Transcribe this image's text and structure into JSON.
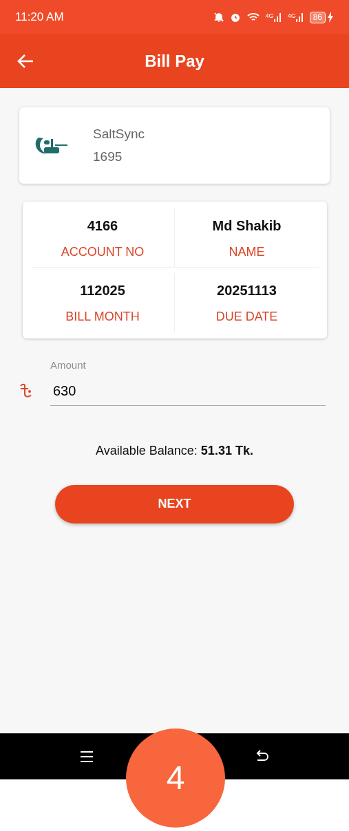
{
  "status_bar": {
    "time": "11:20 AM",
    "network_labels": [
      "4G",
      "4G"
    ],
    "battery": "86",
    "charging": true
  },
  "app_bar": {
    "title": "Bill Pay"
  },
  "biller": {
    "name": "SaltSync",
    "code": "1695"
  },
  "details": [
    {
      "value": "4166",
      "label": "ACCOUNT NO"
    },
    {
      "value": "Md Shakib",
      "label": "NAME"
    },
    {
      "value": "112025",
      "label": "BILL MONTH"
    },
    {
      "value": "20251113",
      "label": "DUE DATE"
    }
  ],
  "amount": {
    "placeholder": "Amount",
    "value": "630"
  },
  "balance": {
    "label": "Available Balance:",
    "value": "51.31 Tk."
  },
  "next_button": "NEXT",
  "step_badge": "4"
}
